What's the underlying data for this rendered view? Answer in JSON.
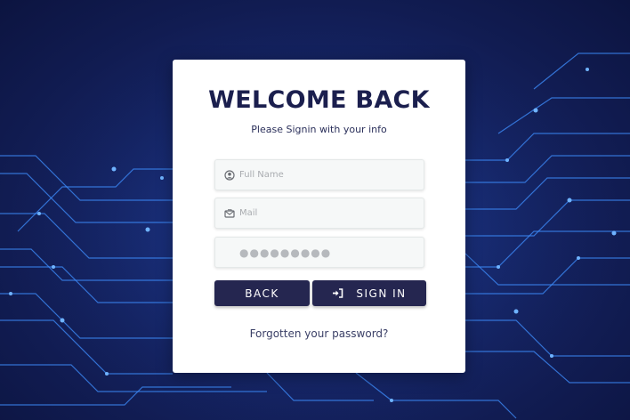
{
  "login": {
    "title": "WELCOME BACK",
    "subtitle": "Please Signin with your info",
    "full_name": {
      "placeholder": "Full Name",
      "value": ""
    },
    "mail": {
      "placeholder": "Mail",
      "value": ""
    },
    "password": {
      "value": "●●●●●●●●●"
    },
    "back_label": "BACK",
    "signin_label": "SIGN IN",
    "forgot_label": "Forgotten your password?"
  },
  "colors": {
    "background": "#17296f",
    "circuit": "#3f8fff",
    "button": "#252650",
    "title": "#1b1f4e"
  },
  "icons": {
    "full_name": "user-circle-icon",
    "mail": "mail-icon",
    "signin": "sign-in-icon"
  }
}
